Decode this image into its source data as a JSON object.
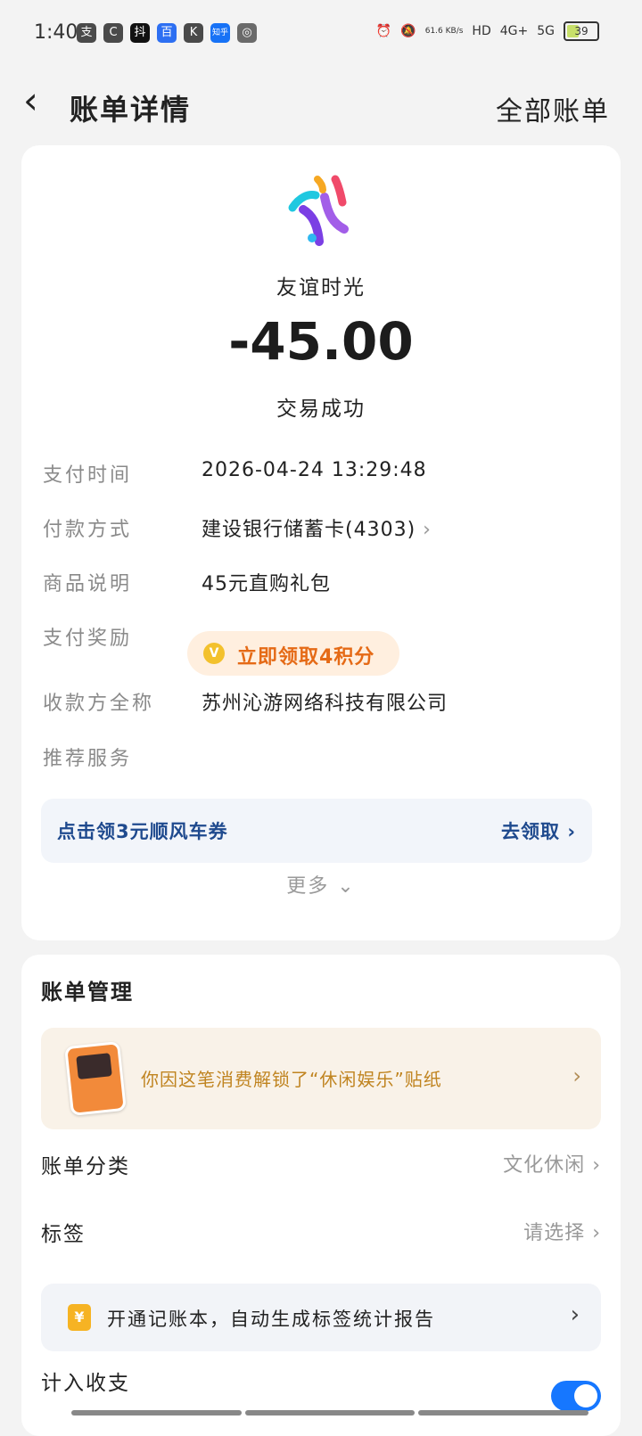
{
  "status_bar": {
    "time": "1:40",
    "app_icons": [
      "支",
      "C",
      "抖",
      "百",
      "K",
      "知乎",
      "◎"
    ],
    "net_speed": "61.6 KB/s",
    "hd": "HD",
    "signal1": "4G+",
    "signal2": "5G",
    "battery": "39"
  },
  "nav": {
    "back_icon": "chevron-left-icon",
    "title": "账单详情",
    "right_action": "全部账单"
  },
  "transaction": {
    "merchant": "友谊时光",
    "amount": "-45.00",
    "status": "交易成功"
  },
  "details": [
    {
      "label": "支付时间",
      "value": "2026-04-24 13:29:48"
    },
    {
      "label": "付款方式",
      "value": "建设银行储蓄卡(4303)"
    },
    {
      "label": "商品说明",
      "value": "45元直购礼包"
    },
    {
      "label": "支付奖励",
      "value": "立即领取4积分"
    },
    {
      "label": "收款方全称",
      "value": "苏州沁游网络科技有限公司"
    },
    {
      "label": "推荐服务",
      "value": ""
    }
  ],
  "promo": {
    "text": "点击领3元顺风车券",
    "action": "去领取"
  },
  "more": "更多",
  "management": {
    "title": "账单管理",
    "sticker_text": "你因这笔消费解锁了“休闲娱乐”贴纸",
    "category_label": "账单分类",
    "category_value": "文化休闲",
    "tag_label": "标签",
    "tag_value": "请选择",
    "tip_icon": "¥",
    "tip_text": "开通记账本，自动生成标签统计报告",
    "include_label": "计入收支",
    "include_enabled": true
  },
  "colors": {
    "accent_blue": "#1677ff",
    "reward_orange": "#e56a16",
    "promo_blue": "#1f4a8e"
  }
}
